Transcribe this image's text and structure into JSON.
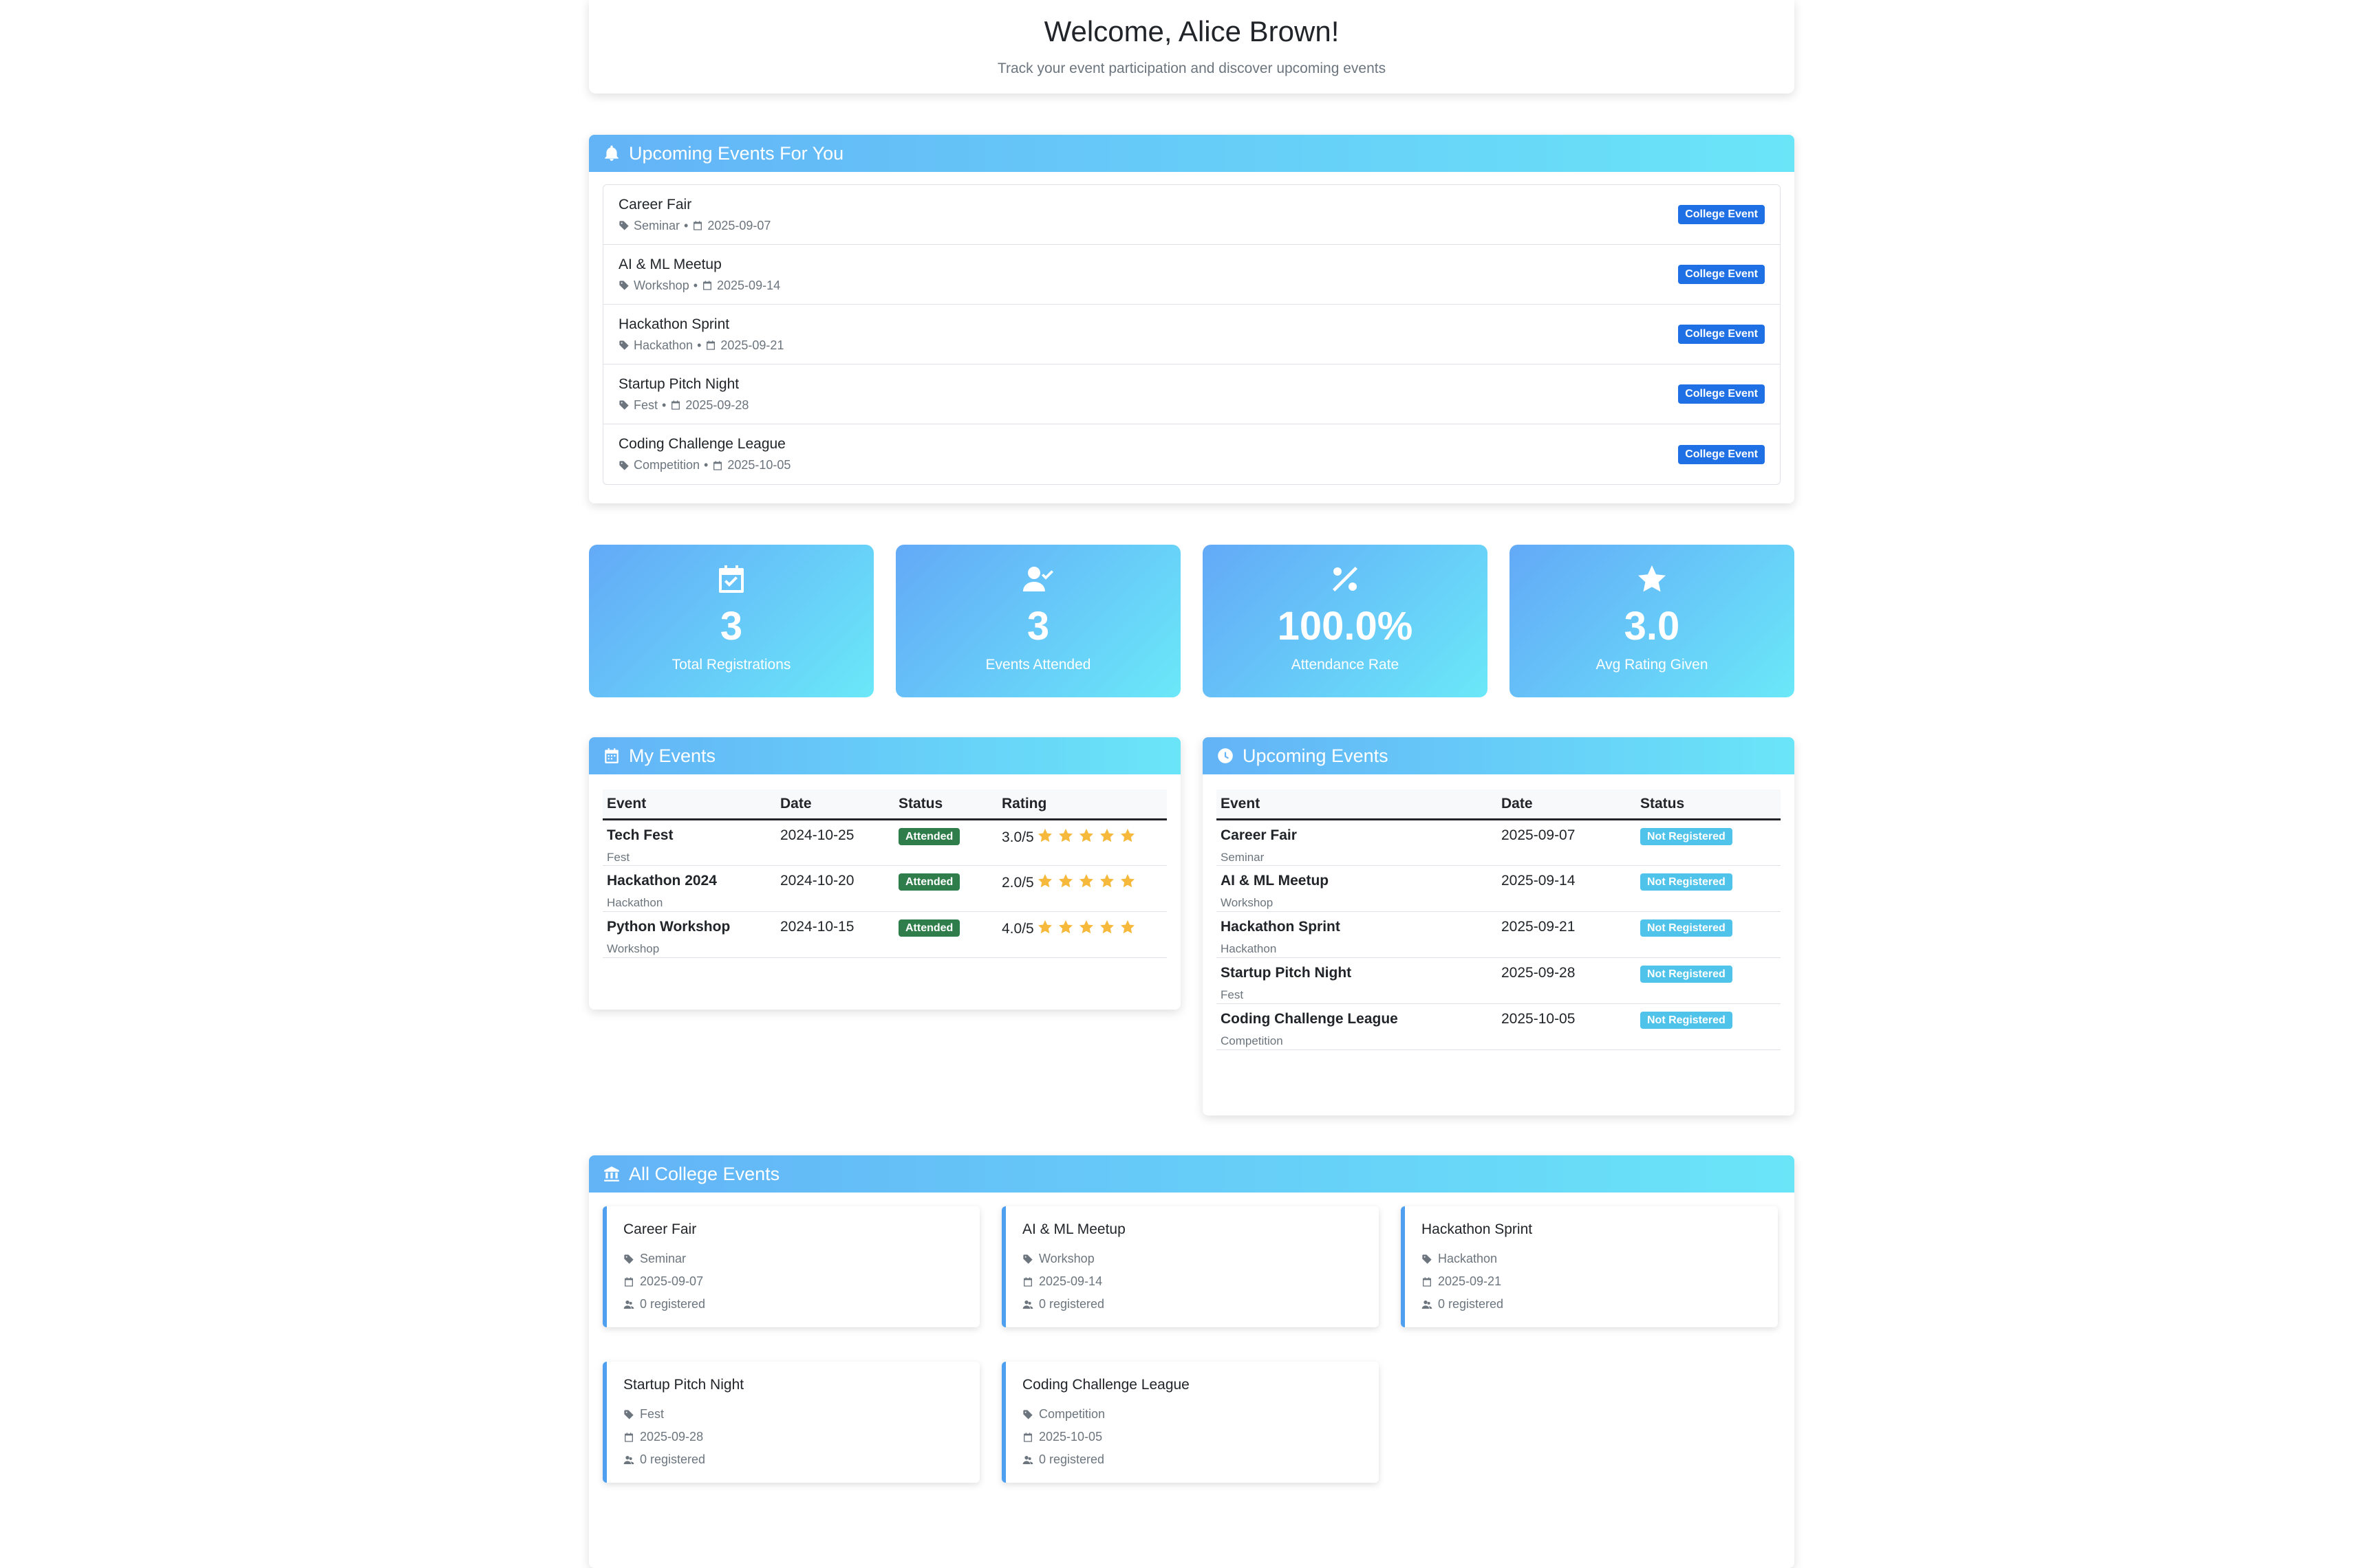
{
  "welcome": {
    "title": "Welcome, Alice Brown!",
    "subtitle": "Track your event participation and discover upcoming events"
  },
  "for_you": {
    "title": "Upcoming Events For You",
    "badge": "College Event",
    "items": [
      {
        "name": "Career Fair",
        "category": "Seminar",
        "date": "2025-09-07"
      },
      {
        "name": "AI & ML Meetup",
        "category": "Workshop",
        "date": "2025-09-14"
      },
      {
        "name": "Hackathon Sprint",
        "category": "Hackathon",
        "date": "2025-09-21"
      },
      {
        "name": "Startup Pitch Night",
        "category": "Fest",
        "date": "2025-09-28"
      },
      {
        "name": "Coding Challenge League",
        "category": "Competition",
        "date": "2025-10-05"
      }
    ]
  },
  "stats": [
    {
      "icon": "calendar-check-icon",
      "value": "3",
      "label": "Total Registrations"
    },
    {
      "icon": "user-check-icon",
      "value": "3",
      "label": "Events Attended"
    },
    {
      "icon": "percent-icon",
      "value": "100.0%",
      "label": "Attendance Rate"
    },
    {
      "icon": "star-icon",
      "value": "3.0",
      "label": "Avg Rating Given"
    }
  ],
  "my_events": {
    "title": "My Events",
    "headers": [
      "Event",
      "Date",
      "Status",
      "Rating"
    ],
    "rows": [
      {
        "name": "Tech Fest",
        "category": "Fest",
        "date": "2024-10-25",
        "status": "Attended",
        "rating": "3.0/5"
      },
      {
        "name": "Hackathon 2024",
        "category": "Hackathon",
        "date": "2024-10-20",
        "status": "Attended",
        "rating": "2.0/5"
      },
      {
        "name": "Python Workshop",
        "category": "Workshop",
        "date": "2024-10-15",
        "status": "Attended",
        "rating": "4.0/5"
      }
    ]
  },
  "upcoming": {
    "title": "Upcoming Events",
    "headers": [
      "Event",
      "Date",
      "Status"
    ],
    "rows": [
      {
        "name": "Career Fair",
        "category": "Seminar",
        "date": "2025-09-07",
        "status": "Not Registered"
      },
      {
        "name": "AI & ML Meetup",
        "category": "Workshop",
        "date": "2025-09-14",
        "status": "Not Registered"
      },
      {
        "name": "Hackathon Sprint",
        "category": "Hackathon",
        "date": "2025-09-21",
        "status": "Not Registered"
      },
      {
        "name": "Startup Pitch Night",
        "category": "Fest",
        "date": "2025-09-28",
        "status": "Not Registered"
      },
      {
        "name": "Coding Challenge League",
        "category": "Competition",
        "date": "2025-10-05",
        "status": "Not Registered"
      }
    ]
  },
  "college": {
    "title": "All College Events",
    "events": [
      {
        "name": "Career Fair",
        "category": "Seminar",
        "date": "2025-09-07",
        "registered": "0 registered"
      },
      {
        "name": "AI & ML Meetup",
        "category": "Workshop",
        "date": "2025-09-14",
        "registered": "0 registered"
      },
      {
        "name": "Hackathon Sprint",
        "category": "Hackathon",
        "date": "2025-09-21",
        "registered": "0 registered"
      },
      {
        "name": "Startup Pitch Night",
        "category": "Fest",
        "date": "2025-09-28",
        "registered": "0 registered"
      },
      {
        "name": "Coding Challenge League",
        "category": "Competition",
        "date": "2025-10-05",
        "registered": "0 registered"
      }
    ]
  },
  "colors": {
    "accent_start": "#63b3f7",
    "accent_end": "#6ae5f8",
    "badge_blue": "#1f6fe5",
    "attended": "#2f7d4a",
    "not_registered": "#4fc3ea",
    "star": "#f6b93b"
  }
}
